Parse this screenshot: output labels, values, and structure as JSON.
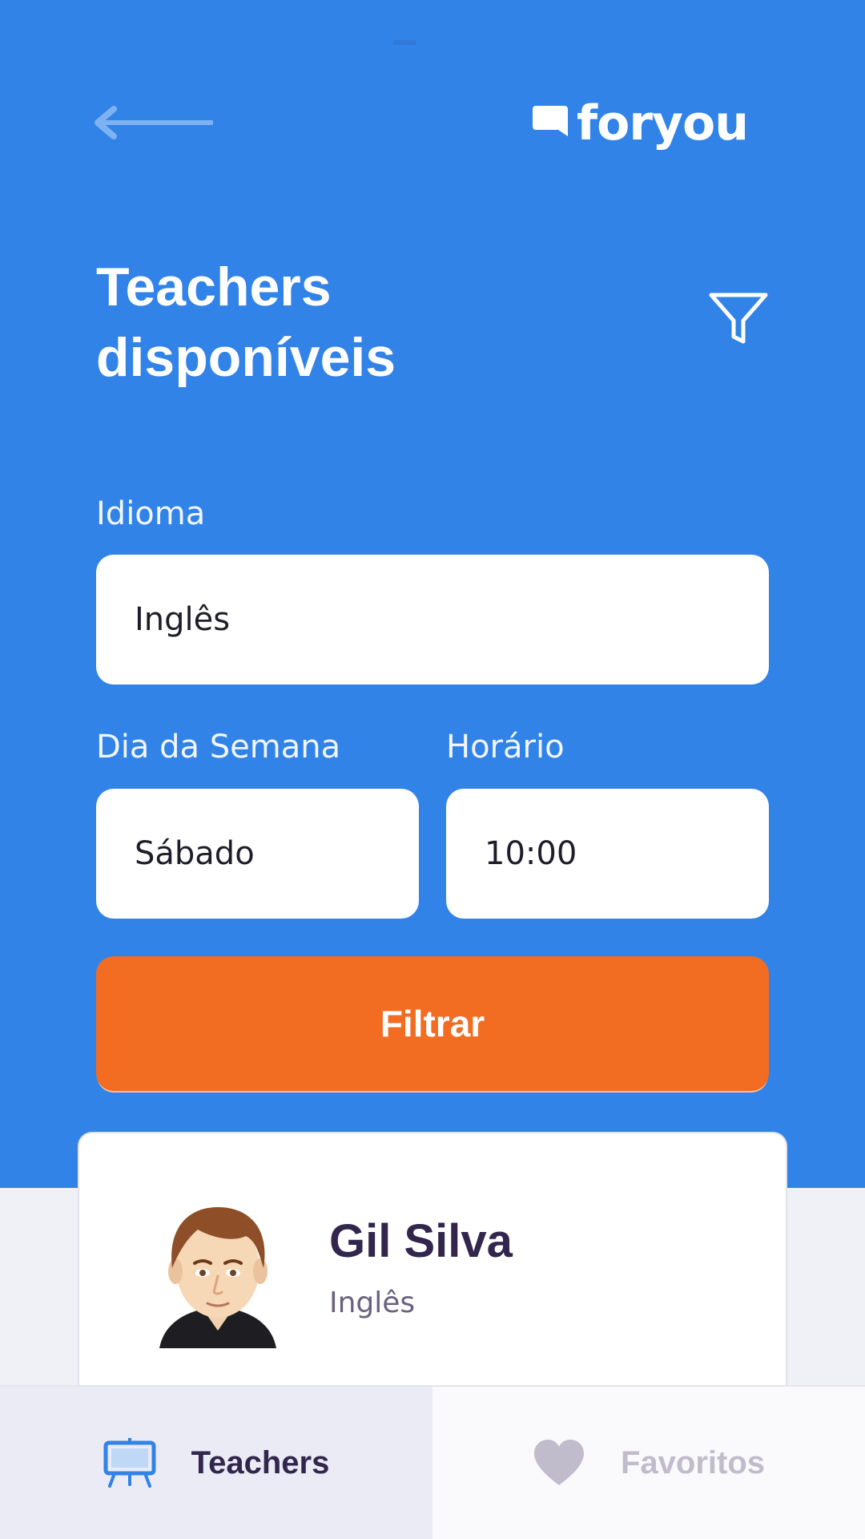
{
  "header": {
    "logo_text": "foryou",
    "title_line1": "Teachers",
    "title_line2": "disponíveis"
  },
  "filters": {
    "idioma_label": "Idioma",
    "idioma_value": "Inglês",
    "dia_label": "Dia da Semana",
    "dia_value": "Sábado",
    "horario_label": "Horário",
    "horario_value": "10:00",
    "button_label": "Filtrar"
  },
  "teacher": {
    "name": "Gil Silva",
    "subject": "Inglês"
  },
  "tabs": [
    {
      "label": "Teachers",
      "icon": "easel-icon",
      "active": true
    },
    {
      "label": "Favoritos",
      "icon": "heart-icon",
      "active": false
    }
  ],
  "colors": {
    "primary": "#3183E8",
    "accent": "#F26C21",
    "text_dark": "#32264D",
    "text_muted": "#C1BCCC"
  }
}
